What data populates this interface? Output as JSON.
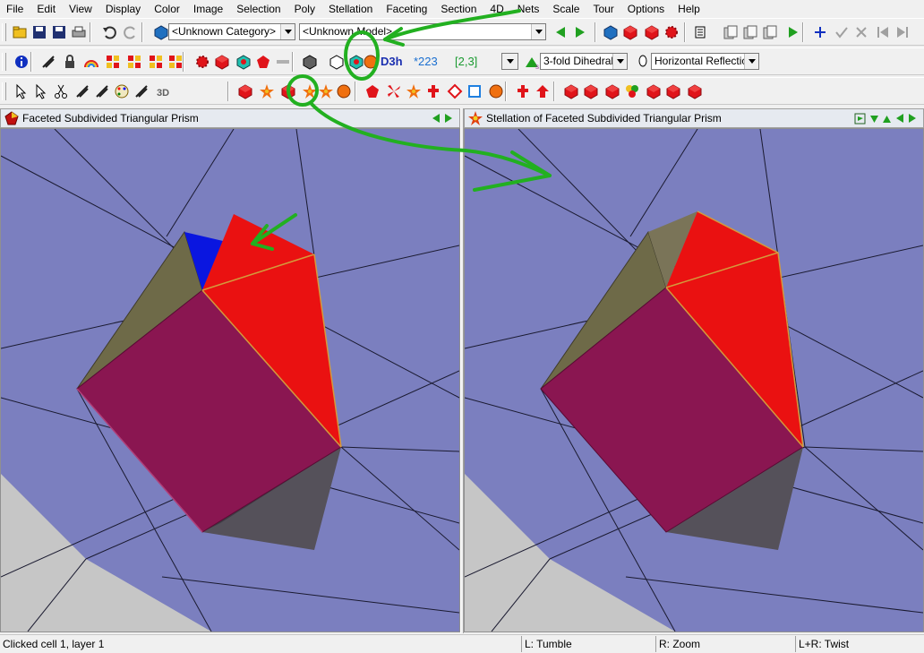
{
  "menu": [
    "File",
    "Edit",
    "View",
    "Display",
    "Color",
    "Image",
    "Selection",
    "Poly",
    "Stellation",
    "Faceting",
    "Section",
    "4D",
    "Nets",
    "Scale",
    "Tour",
    "Options",
    "Help"
  ],
  "toolbar1": {
    "category_value": "<Unknown Category>",
    "model_value": "<Unknown Model>"
  },
  "toolbar2": {
    "symmetry_group": "D3h",
    "orbifold": "*223",
    "coxeter": "[2,3]",
    "axis_select": "3-fold Dihedral",
    "reflection_select": "Horizontal Reflection"
  },
  "left_pane": {
    "title": "Faceted Subdivided Triangular Prism"
  },
  "right_pane": {
    "title": "Stellation of Faceted Subdivided Triangular Prism"
  },
  "status": {
    "message": "Clicked cell 1, layer 1",
    "left_mouse": "L: Tumble",
    "right_mouse": "R: Zoom",
    "both_mouse": "L+R: Twist"
  },
  "icons": {
    "tb1": [
      "open-icon",
      "save-icon",
      "save-all-icon",
      "print-icon",
      "undo-icon",
      "redo-icon",
      "library-icon",
      "prev-model-icon",
      "next-model-icon",
      "dice-icon",
      "random-model-icon",
      "red-cube-icon",
      "gear-model-icon",
      "list-icon",
      "export-icon",
      "import-icon",
      "copy-icon",
      "play-icon",
      "add-icon",
      "check-icon",
      "delete-icon",
      "first-icon",
      "last-icon"
    ],
    "tb2": [
      "info-icon",
      "tools-icon",
      "lock-icon",
      "rainbow-icon",
      "face-pattern-icon",
      "face-pattern-2-icon",
      "face-pattern-3-icon",
      "face-pattern-4-icon",
      "red-gear-icon",
      "red-cube-icon",
      "compound-icon",
      "pentagon-icon",
      "bar-icon",
      "dark-cube-icon",
      "outline-cube-icon",
      "symmetry-cube-icon",
      "globe-icon",
      "elevation-icon",
      "lamp-icon"
    ],
    "tb3": [
      "select-icon",
      "multi-select-icon",
      "scissors-icon",
      "measure-icon",
      "net-icon",
      "palette-icon",
      "stripes-icon",
      "3d-text-icon",
      "solid-poly-icon",
      "stellate-icon",
      "facet-icon",
      "stellation-icon",
      "star-poly-icon",
      "sphere-icon",
      "pentagon-icon",
      "fan-icon",
      "star-icon",
      "cross-icon",
      "diamond-icon",
      "square-icon",
      "disk-icon",
      "cross-red-icon",
      "arrow-red-icon",
      "red-poly-1-icon",
      "red-poly-2-icon",
      "red-poly-3-icon",
      "multi-poly-icon",
      "red-poly-4-icon",
      "red-poly-5-icon",
      "red-poly-6-icon"
    ]
  },
  "colors": {
    "viewport_bg": "#7b7fbf",
    "face_red": "#ea1111",
    "face_maroon": "#8a1651",
    "face_olive": "#6e6a48",
    "face_blue": "#0a16e0",
    "annotation_green": "#22b020"
  }
}
